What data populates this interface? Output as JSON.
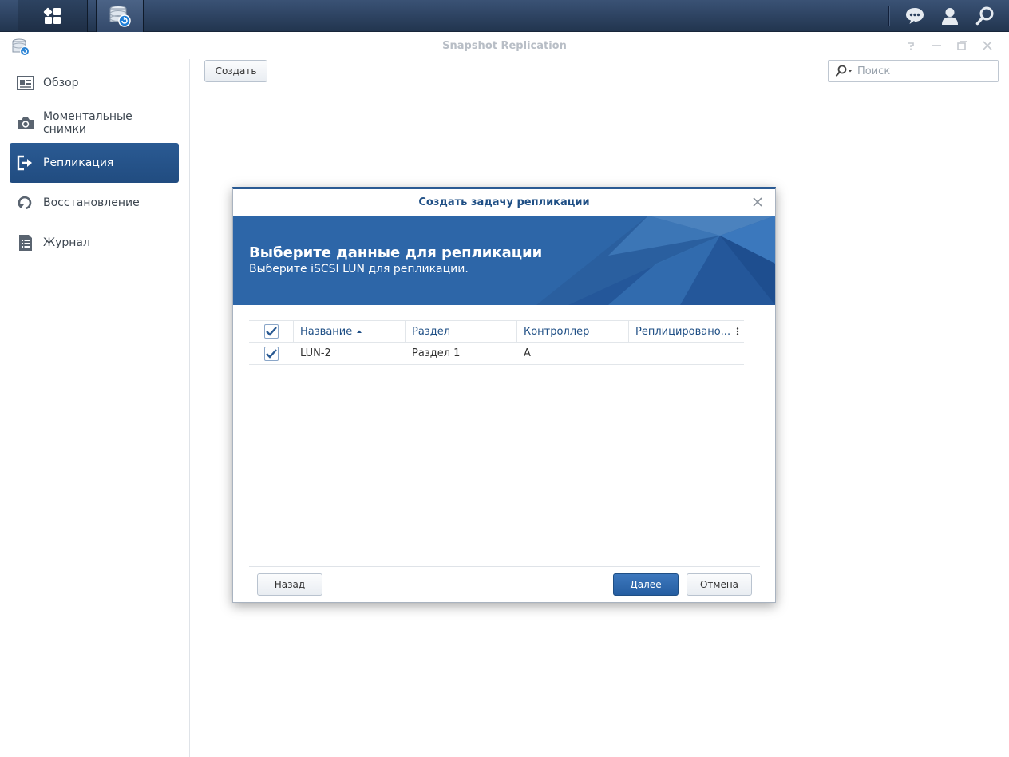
{
  "window": {
    "title": "Snapshot Replication"
  },
  "toolbar": {
    "create_label": "Создать",
    "search_placeholder": "Поиск"
  },
  "sidebar": {
    "items": [
      {
        "label": "Обзор",
        "icon": "overview-icon",
        "active": false
      },
      {
        "label": "Моментальные снимки",
        "icon": "camera-icon",
        "active": false
      },
      {
        "label": "Репликация",
        "icon": "replication-icon",
        "active": true
      },
      {
        "label": "Восстановление",
        "icon": "restore-icon",
        "active": false
      },
      {
        "label": "Журнал",
        "icon": "log-icon",
        "active": false
      }
    ]
  },
  "dialog": {
    "title": "Создать задачу репликации",
    "banner_title": "Выберите данные для репликации",
    "banner_subtitle": "Выберите iSCSI LUN для репликации.",
    "columns": [
      "Название",
      "Раздел",
      "Контроллер",
      "Реплицировано..."
    ],
    "sort_column": "Название",
    "rows": [
      {
        "checked": true,
        "name": "LUN-2",
        "volume": "Раздел 1",
        "controller": "A",
        "replicated": ""
      }
    ],
    "buttons": {
      "back": "Назад",
      "next": "Далее",
      "cancel": "Отмена"
    }
  },
  "colors": {
    "accent": "#2a5a93",
    "banner": "#2d66a8",
    "taskbar": "#2b405e"
  }
}
